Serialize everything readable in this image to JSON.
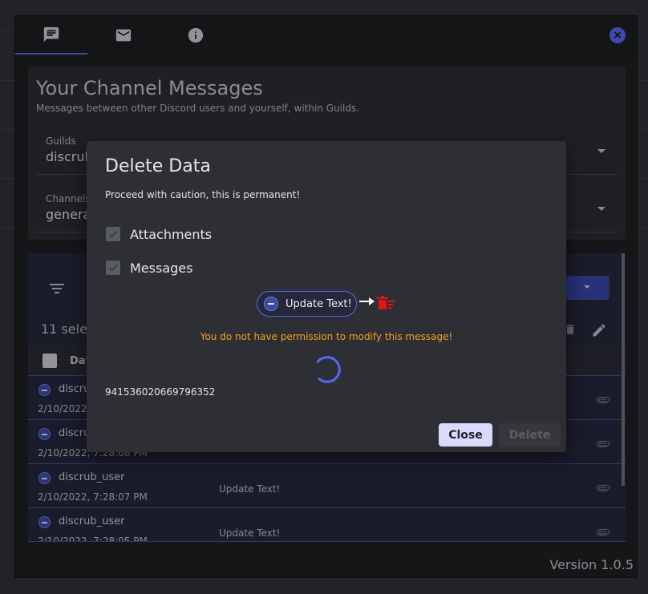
{
  "nav": {
    "tabs": [
      {
        "icon": "chat-icon",
        "active": true
      },
      {
        "icon": "mail-icon",
        "active": false
      },
      {
        "icon": "info-icon",
        "active": false
      }
    ],
    "close_glyph": "×"
  },
  "channel_card": {
    "title": "Your Channel Messages",
    "subtitle": "Messages between other Discord users and yourself, within Guilds.",
    "guilds_label": "Guilds",
    "guilds_value": "discrub",
    "channels_label": "Channels",
    "channels_value": "genera"
  },
  "table": {
    "selected_count_text": "11 selec",
    "header_label": "Dat",
    "rows": [
      {
        "username": "discrub",
        "date": "2/10/2022,",
        "message": ""
      },
      {
        "username": "discrub",
        "date": "2/10/2022, 7:28:08 PM",
        "message": ""
      },
      {
        "username": "discrub_user",
        "date": "2/10/2022, 7:28:07 PM",
        "message": "Update Text!"
      },
      {
        "username": "discrub_user",
        "date": "2/10/2022, 7:28:05 PM",
        "message": "Update Text!"
      }
    ]
  },
  "footer": {
    "version": "Version 1.0.5"
  },
  "dialog": {
    "title": "Delete Data",
    "warning_intro": "Proceed with caution, this is permanent!",
    "attachments_label": "Attachments",
    "messages_label": "Messages",
    "chip_label": "Update Text!",
    "error_text": "You do not have permission to modify this message!",
    "message_id": "941536020669796352",
    "close_button": "Close",
    "delete_button": "Delete"
  },
  "colors": {
    "accent": "#5865f2",
    "warning": "#f0a020",
    "danger": "#e01515"
  }
}
